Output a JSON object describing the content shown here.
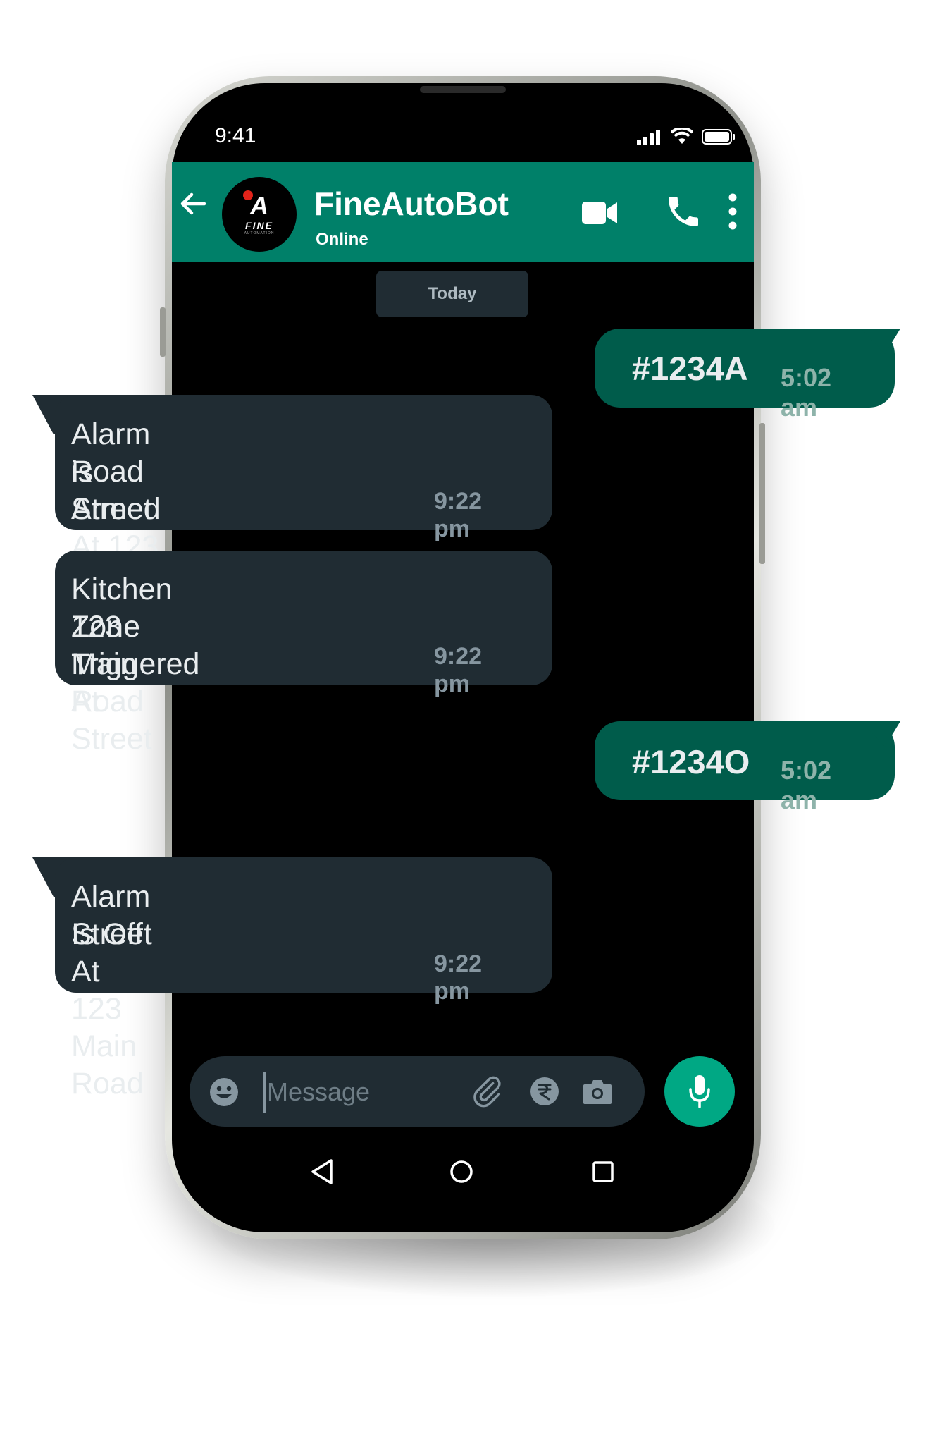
{
  "status_bar": {
    "time": "9:41"
  },
  "header": {
    "contact_name": "FineAutoBot",
    "contact_status": "Online",
    "avatar": {
      "logo_text": "A",
      "brand_text": "FINE",
      "brand_sub": "AUTOMATION"
    },
    "icons": [
      "back-arrow-icon",
      "video-call-icon",
      "phone-call-icon",
      "more-options-icon"
    ]
  },
  "date_chip": "Today",
  "messages": [
    {
      "direction": "out",
      "text": "#1234A",
      "time": "5:02 am"
    },
    {
      "direction": "in",
      "lines": [
        "Alarm is Armed At 123 Main",
        "Road Street"
      ],
      "time": "9:22 pm"
    },
    {
      "direction": "in",
      "lines": [
        "Kitchen Zone Triggered At",
        "123 Main Road Street"
      ],
      "time": "9:22 pm"
    },
    {
      "direction": "out",
      "text": "#1234O",
      "time": "5:02 am"
    },
    {
      "direction": "in",
      "lines": [
        "Alarm Is Off At 123 Main Road",
        "Street"
      ],
      "time": "9:22 pm"
    }
  ],
  "composer": {
    "placeholder": "Message",
    "icons": [
      "emoji-icon",
      "attach-icon",
      "rupee-payment-icon",
      "camera-icon",
      "mic-icon"
    ]
  },
  "nav_bar": {
    "icons": [
      "back-triangle-icon",
      "home-circle-icon",
      "recents-square-icon"
    ]
  },
  "colors": {
    "header_green": "#008069",
    "outgoing_bubble": "#005c4b",
    "incoming_bubble": "#202c33",
    "mic_button": "#00a884"
  }
}
